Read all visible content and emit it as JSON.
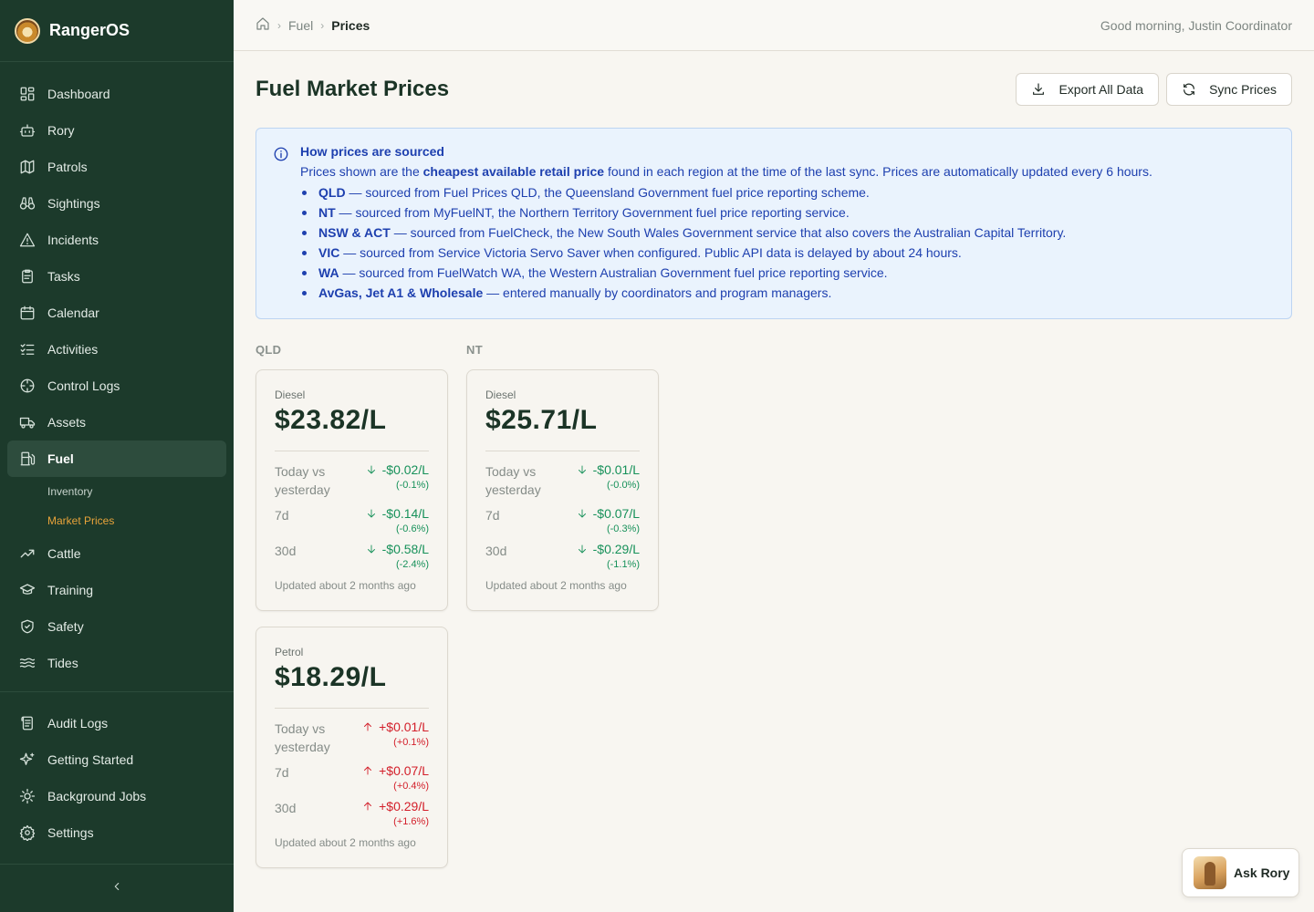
{
  "app": {
    "name": "RangerOS"
  },
  "sidebar": {
    "items": [
      {
        "label": "Dashboard",
        "icon": "dashboard-icon"
      },
      {
        "label": "Rory",
        "icon": "robot-icon"
      },
      {
        "label": "Patrols",
        "icon": "map-icon"
      },
      {
        "label": "Sightings",
        "icon": "binoculars-icon"
      },
      {
        "label": "Incidents",
        "icon": "warning-icon"
      },
      {
        "label": "Tasks",
        "icon": "clipboard-icon"
      },
      {
        "label": "Calendar",
        "icon": "calendar-icon"
      },
      {
        "label": "Activities",
        "icon": "list-check-icon"
      },
      {
        "label": "Control Logs",
        "icon": "crosshair-icon"
      },
      {
        "label": "Assets",
        "icon": "truck-icon"
      },
      {
        "label": "Fuel",
        "icon": "fuel-pump-icon"
      }
    ],
    "fuel_sub": [
      {
        "label": "Inventory"
      },
      {
        "label": "Market Prices"
      }
    ],
    "items2": [
      {
        "label": "Cattle",
        "icon": "trend-icon"
      },
      {
        "label": "Training",
        "icon": "graduation-cap-icon"
      },
      {
        "label": "Safety",
        "icon": "shield-icon"
      },
      {
        "label": "Tides",
        "icon": "waves-icon"
      }
    ],
    "items3": [
      {
        "label": "Audit Logs",
        "icon": "scroll-icon"
      },
      {
        "label": "Getting Started",
        "icon": "sparkles-icon"
      },
      {
        "label": "Background Jobs",
        "icon": "cog-icon"
      },
      {
        "label": "Settings",
        "icon": "gear-icon"
      }
    ]
  },
  "topbar": {
    "breadcrumb": [
      "Fuel",
      "Prices"
    ],
    "greeting": "Good morning, Justin Coordinator"
  },
  "page": {
    "title": "Fuel Market Prices",
    "export_label": "Export All Data",
    "sync_label": "Sync Prices"
  },
  "info": {
    "title": "How prices are sourced",
    "text_before": "Prices shown are the ",
    "text_bold": "cheapest available retail price",
    "text_after": " found in each region at the time of the last sync. Prices are automatically updated every 6 hours.",
    "bullets": [
      {
        "bold": "QLD",
        "text": " — sourced from Fuel Prices QLD, the Queensland Government fuel price reporting scheme."
      },
      {
        "bold": "NT",
        "text": " — sourced from MyFuelNT, the Northern Territory Government fuel price reporting service."
      },
      {
        "bold": "NSW & ACT",
        "text": " — sourced from FuelCheck, the New South Wales Government service that also covers the Australian Capital Territory."
      },
      {
        "bold": "VIC",
        "text": " — sourced from Service Victoria Servo Saver when configured. Public API data is delayed by about 24 hours."
      },
      {
        "bold": "WA",
        "text": " — sourced from FuelWatch WA, the Western Australian Government fuel price reporting service."
      },
      {
        "bold": "AvGas, Jet A1 & Wholesale",
        "text": " — entered manually by coordinators and program managers."
      }
    ]
  },
  "regions": [
    {
      "name": "QLD",
      "cards": [
        {
          "type": "Diesel",
          "price": "$23.82/L",
          "direction": "down",
          "stats": [
            {
              "label": "Today vs yesterday",
              "abs": "-$0.02/L",
              "pct": "(-0.1%)"
            },
            {
              "label": "7d",
              "abs": "-$0.14/L",
              "pct": "(-0.6%)"
            },
            {
              "label": "30d",
              "abs": "-$0.58/L",
              "pct": "(-2.4%)"
            }
          ],
          "updated": "Updated about 2 months ago"
        },
        {
          "type": "Petrol",
          "price": "$18.29/L",
          "direction": "up",
          "stats": [
            {
              "label": "Today vs yesterday",
              "abs": "+$0.01/L",
              "pct": "(+0.1%)"
            },
            {
              "label": "7d",
              "abs": "+$0.07/L",
              "pct": "(+0.4%)"
            },
            {
              "label": "30d",
              "abs": "+$0.29/L",
              "pct": "(+1.6%)"
            }
          ],
          "updated": "Updated about 2 months ago"
        }
      ]
    },
    {
      "name": "NT",
      "cards": [
        {
          "type": "Diesel",
          "price": "$25.71/L",
          "direction": "down",
          "stats": [
            {
              "label": "Today vs yesterday",
              "abs": "-$0.01/L",
              "pct": "(-0.0%)"
            },
            {
              "label": "7d",
              "abs": "-$0.07/L",
              "pct": "(-0.3%)"
            },
            {
              "label": "30d",
              "abs": "-$0.29/L",
              "pct": "(-1.1%)"
            }
          ],
          "updated": "Updated about 2 months ago"
        }
      ]
    }
  ],
  "ask": {
    "label": "Ask Rory"
  },
  "colors": {
    "sidebar": "#1c3a2b",
    "accent": "#e8a33a",
    "down": "#17915a",
    "up": "#d31f2a",
    "info": "#1e40af"
  }
}
